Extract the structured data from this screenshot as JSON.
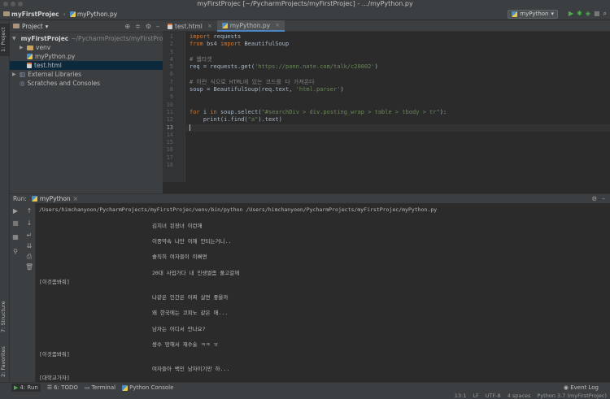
{
  "window": {
    "title": "myFirstProjec [~/PycharmProjects/myFirstProjec] - .../myPython.py"
  },
  "navbar": {
    "project": "myFirstProjec",
    "file": "myPython.py",
    "run_config": "myPython"
  },
  "left_strip": {
    "project_tab": "1: Project",
    "structure_tab": "7: Structure",
    "favorites_tab": "2: Favorites"
  },
  "project_panel": {
    "header": "Project",
    "tree": [
      {
        "label": "myFirstProjec",
        "extra": "~/PycharmProjects/myFirstProjec"
      },
      {
        "label": "venv"
      },
      {
        "label": "myPython.py"
      },
      {
        "label": "test.html"
      },
      {
        "label": "External Libraries"
      },
      {
        "label": "Scratches and Consoles"
      }
    ]
  },
  "editor": {
    "tabs": [
      {
        "label": "test.html"
      },
      {
        "label": "myPython.py"
      }
    ],
    "line_numbers": [
      "1",
      "2",
      "3",
      "4",
      "5",
      "6",
      "7",
      "8",
      "9",
      "10",
      "11",
      "12",
      "13",
      "14",
      "15",
      "16",
      "17",
      "18"
    ],
    "code": {
      "l1_kw": "import",
      "l1_rest": " requests",
      "l2_kw1": "from",
      "l2_mid": " bs4 ",
      "l2_kw2": "import",
      "l2_rest": " BeautifulSoup",
      "l4": "# 웹타겟",
      "l5_pre": "req = requests.get(",
      "l5_str": "'https://pann.nate.com/talk/c20002'",
      "l5_post": ")",
      "l7": "# 이런 식으로 HTML에 있는 코드를 다 가져온다",
      "l8_pre": "soup = BeautifulSoup(req.text, ",
      "l8_str": "'html.parser'",
      "l8_post": ")",
      "l11_kw1": "for",
      "l11_mid": " i ",
      "l11_kw2": "in",
      "l11_pre": " soup.select(",
      "l11_str": "\"#searchDiv > div.posting_wrap > table > tbody > tr\"",
      "l11_post": "):",
      "l12_pre": "    print(i.find(",
      "l12_str": "\"a\"",
      "l12_post": ").text)"
    }
  },
  "run": {
    "label": "Run:",
    "tab": "myPython",
    "command": "/Users/himchanyoon/PycharmProjects/myFirstProjec/venv/bin/python /Users/himchanyoon/PycharmProjects/myFirstProjec/myPython.py",
    "output": [
      "김치녀 된장녀 이런애",
      "이중약속 나만 이해 안되는거니..",
      "솔직히 여자들이 이뻐면",
      "20대 사업가다 내 인생썰좀 풀고갈께",
      "[이것좀봐줘]",
      "나같은 인간은 어찌 살면 좋을까",
      "왜 한국에는 코피노 같은 애...",
      "남자는 어디서 만나요?",
      "썅수 망해서 재수술 ㅋㅋ ㅠ",
      "[이것좀봐줘]",
      "여자들아 백인 남자이기만 하...",
      "[대학교가자]"
    ]
  },
  "statusbar": {
    "tabs": [
      "4: Run",
      "6: TODO",
      "Terminal",
      "Python Console"
    ],
    "event_log": "Event Log",
    "position": "13:1",
    "line_sep": "LF",
    "encoding": "UTF-8",
    "indent": "4 spaces",
    "interpreter": "Python 3.7 (myFirstProjec)"
  }
}
